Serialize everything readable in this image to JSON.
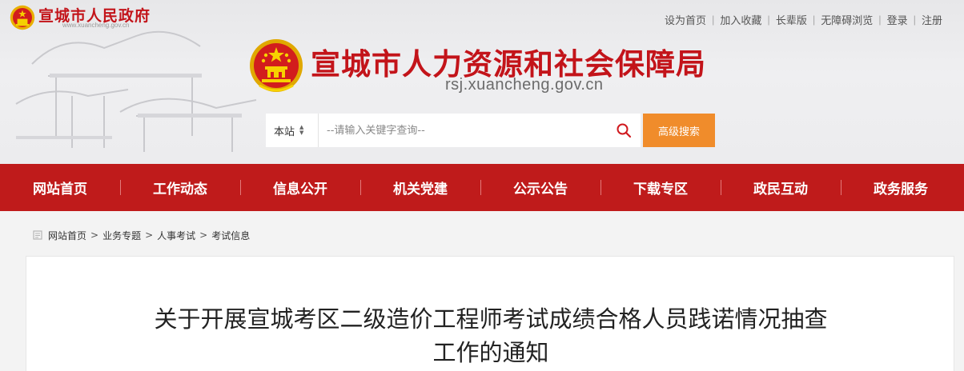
{
  "header": {
    "gov_name": "宣城市人民政府",
    "gov_url": "www.xuancheng.gov.cn",
    "bureau_name": "宣城市人力资源和社会保障局",
    "bureau_url": "rsj.xuancheng.gov.cn",
    "links": [
      "设为首页",
      "加入收藏",
      "长辈版",
      "无障碍浏览",
      "登录",
      "注册"
    ]
  },
  "search": {
    "scope": "本站",
    "placeholder": "--请输入关键字查询--",
    "advanced_label": "高级搜索"
  },
  "nav": {
    "items": [
      "网站首页",
      "工作动态",
      "信息公开",
      "机关党建",
      "公示公告",
      "下载专区",
      "政民互动",
      "政务服务"
    ]
  },
  "breadcrumb": {
    "items": [
      "网站首页",
      "业务专题",
      "人事考试",
      "考试信息"
    ],
    "separator": ">"
  },
  "article": {
    "title_line1": "关于开展宣城考区二级造价工程师考试成绩合格人员践诺情况抽查",
    "title_line2": "工作的通知"
  },
  "colors": {
    "brand_red": "#c3141a",
    "nav_red": "#bf1b1b",
    "search_orange": "#f08c2b"
  }
}
